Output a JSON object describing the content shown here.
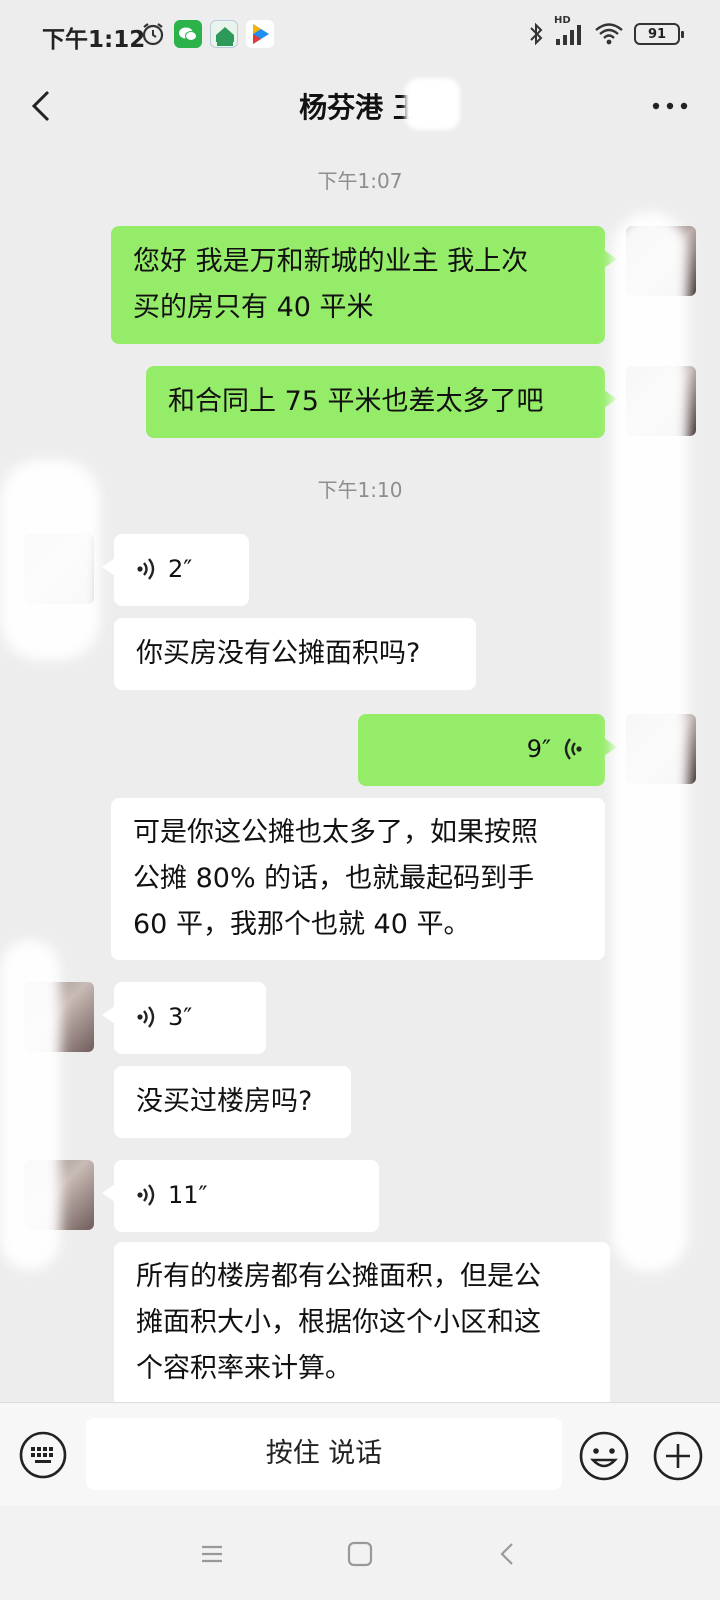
{
  "status_bar": {
    "time": "下午1:12",
    "battery": "91",
    "network_label": "HD"
  },
  "header": {
    "title": "杨芬港 王"
  },
  "messages": [
    {
      "type": "timestamp",
      "text": "下午1:07"
    },
    {
      "type": "text",
      "side": "me",
      "lines": [
        "您好 我是万和新城的业主 我上次",
        "买的房只有 40 平米"
      ]
    },
    {
      "type": "text",
      "side": "me",
      "lines": [
        "和合同上 75 平米也差太多了吧"
      ]
    },
    {
      "type": "timestamp",
      "text": "下午1:10"
    },
    {
      "type": "voice",
      "side": "other",
      "duration": "2″"
    },
    {
      "type": "text",
      "side": "other",
      "lines": [
        "你买房没有公摊面积吗?"
      ]
    },
    {
      "type": "voice",
      "side": "me",
      "duration": "9″"
    },
    {
      "type": "text",
      "side": "me",
      "lines": [
        "可是你这公摊也太多了，如果按照",
        "公摊 80% 的话，也就最起码到手",
        "60 平，我那个也就 40 平。"
      ]
    },
    {
      "type": "voice",
      "side": "other",
      "duration": "3″"
    },
    {
      "type": "text",
      "side": "other",
      "lines": [
        "没买过楼房吗?"
      ]
    },
    {
      "type": "voice",
      "side": "other",
      "duration": "11″"
    },
    {
      "type": "text",
      "side": "other",
      "lines": [
        "所有的楼房都有公摊面积，但是公",
        "摊面积大小，根据你这个小区和这",
        "个容积率来计算。"
      ]
    }
  ],
  "input_bar": {
    "hold_to_talk": "按住 说话"
  },
  "colors": {
    "my_bubble": "#95ec69",
    "other_bubble": "#ffffff",
    "background": "#ededed"
  },
  "icons": [
    "alarm-icon",
    "wechat-icon",
    "home-app-icon",
    "video-app-icon",
    "bluetooth-icon",
    "signal-icon",
    "wifi-icon",
    "battery-icon",
    "back-icon",
    "more-icon",
    "voice-wave-icon",
    "keyboard-icon",
    "emoji-icon",
    "plus-icon",
    "menu-key-icon",
    "home-key-icon",
    "back-key-icon"
  ]
}
